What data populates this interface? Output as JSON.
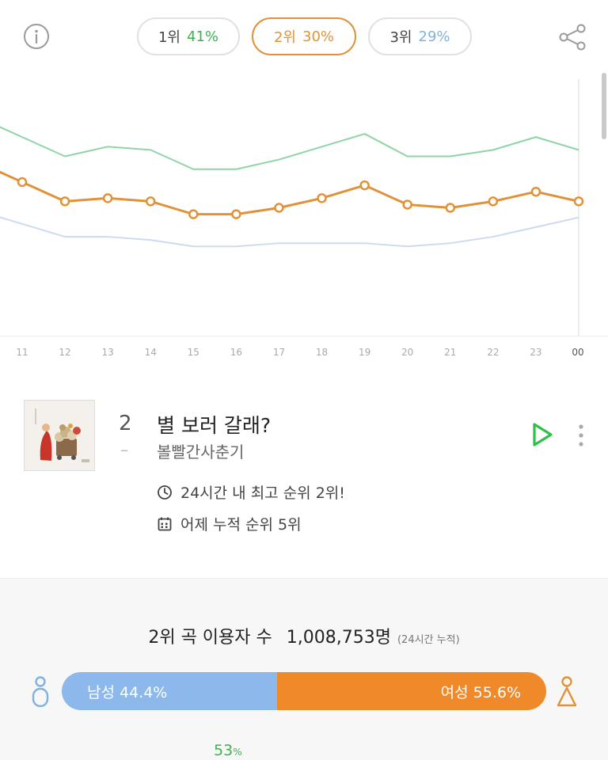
{
  "header": {
    "info_icon": "info-circle-icon",
    "share_icon": "share-icon",
    "tabs": [
      {
        "rank": "1위",
        "pct": "41%",
        "color": "#3cb44b",
        "active": false
      },
      {
        "rank": "2위",
        "pct": "30%",
        "color": "#e0923a",
        "active": true
      },
      {
        "rank": "3위",
        "pct": "29%",
        "color": "#7fb2e0",
        "active": false
      }
    ]
  },
  "chart_data": {
    "type": "line",
    "x": [
      "11",
      "12",
      "13",
      "14",
      "15",
      "16",
      "17",
      "18",
      "19",
      "20",
      "21",
      "22",
      "23",
      "00"
    ],
    "series": [
      {
        "color": "#8fd4a4",
        "values": [
          62,
          56,
          59,
          58,
          52,
          52,
          55,
          59,
          63,
          56,
          56,
          58,
          62,
          58
        ]
      },
      {
        "color": "#e0923a",
        "values": [
          48,
          42,
          43,
          42,
          38,
          38,
          40,
          43,
          47,
          41,
          40,
          42,
          45,
          42
        ]
      },
      {
        "color": "#c9dcf0",
        "values": [
          35,
          31,
          31,
          30,
          28,
          28,
          29,
          29,
          29,
          28,
          29,
          31,
          34,
          37
        ]
      }
    ],
    "ylim": [
      0,
      80
    ],
    "grid": false
  },
  "song": {
    "rank": "2",
    "change": "–",
    "title": "별 보러 갈래?",
    "artist": "볼빨간사춘기",
    "best_rank_text": "24시간 내 최고 순위 2위!",
    "cumulative_text": "어제 누적 순위 5위",
    "play_icon": "play-icon",
    "more_icon": "more-vertical-icon",
    "clock_icon": "clock-icon",
    "calendar_icon": "calendar-icon"
  },
  "stats": {
    "label": "2위 곡 이용자 수",
    "count": "1,008,753명",
    "note": "(24시간 누적)",
    "male_label": "남성 44.4%",
    "female_label": "여성 55.6%",
    "male_fraction": 0.444,
    "male_color": "#8cb8ec",
    "female_color": "#f0892a",
    "age_pct": "53",
    "age_pct_unit": "%"
  }
}
